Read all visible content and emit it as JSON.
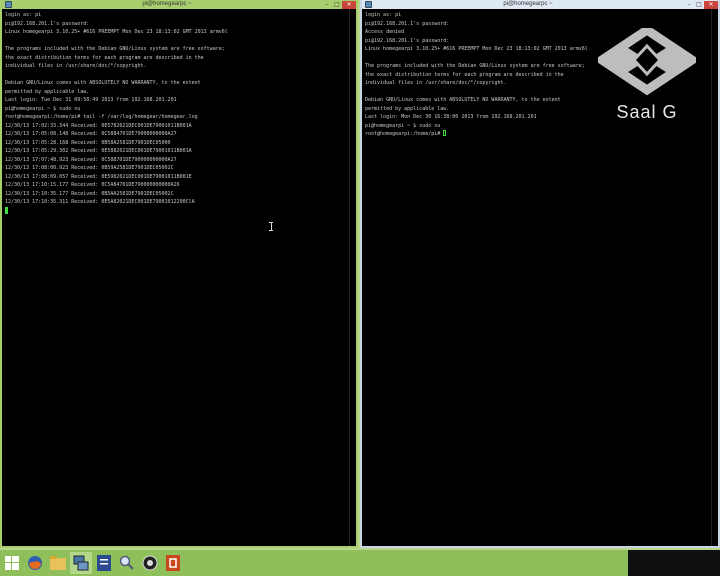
{
  "left_window": {
    "title": "pi@homegearpc ~",
    "lines": [
      "login as: pi",
      "pi@192.168.201.1's password:",
      "Linux homegearpi 3.10.25+ #616 PREEMPT Mon Dec 23 18:13:02 GMT 2013 armv6l",
      "",
      "The programs included with the Debian GNU/Linux system are free software;",
      "the exact distribution terms for each program are described in the",
      "individual files in /usr/share/doc/*/copyright.",
      "",
      "Debian GNU/Linux comes with ABSOLUTELY NO WARRANTY, to the extent",
      "permitted by applicable law.",
      "Last login: Tue Dec 31 09:58:49 2013 from 192.168.201.201",
      "pi@homegearpi ~ $ sudo su",
      "root@homegearpi:/home/pi# tail -f /var/log/homegear/homegear.log",
      "12/30/13 17:02:33.344 Received: 0E5782021DEC001DE79001011B001A",
      "12/30/13 17:05:08.148 Received: 0C5884701DE79000000000A27",
      "12/30/13 17:05:28.168 Received: 0B58A2581DE7901DEC05000",
      "12/30/13 17:05:29.302 Received: 0E5882021DEC001DE79001011B001A",
      "12/30/13 17:07:48.923 Received: 0C588701DE790000000000A27",
      "12/30/13 17:08:00.923 Received: 0B59A2581DE7901DEC05002C",
      "12/30/13 17:08:09.057 Received: 0E5982021DEC001DE79001011B001E",
      "12/30/13 17:10:15.177 Received: 0C5A84701DE790000000000A26",
      "12/30/13 17:10:35.177 Received: 0B5AA2581DE7901DEC05002C",
      "12/30/13 17:10:35.311 Received: 0E5A82021DEC001DE79001012200ClA"
    ]
  },
  "right_window": {
    "title": "pi@homegearpc ~",
    "lines": [
      "login as: pi",
      "pi@192.168.201.1's password:",
      "Access denied",
      "pi@192.168.201.1's password:",
      "Linux homegearpi 3.10.25+ #616 PREEMPT Mon Dec 23 18:13:02 GMT 2013 armv6l",
      "",
      "The programs included with the Debian GNU/Linux system are free software;",
      "the exact distribution terms for each program are described in the",
      "individual files in /usr/share/doc/*/copyright.",
      "",
      "Debian GNU/Linux comes with ABSOLUTELY NO WARRANTY, to the extent",
      "permitted by applicable law.",
      "Last login: Mon Dec 30 16:38:00 2013 from 192.168.201.201",
      "pi@homegearpi ~ $ sudo su"
    ],
    "prompt": "root@homegearpi:/home/pi# "
  },
  "watermark": {
    "text": "Saal G"
  },
  "taskbar": {
    "apps": [
      "windows-start-icon",
      "firefox-icon",
      "file-explorer-icon",
      "putty-icon",
      "word-icon",
      "search-tool-icon",
      "app-icon",
      "powerpoint-icon"
    ],
    "active_app": "putty-icon"
  },
  "colors": {
    "terminal_text": "#c8c8c8",
    "cursor": "#3ee03e",
    "left_frame": "#a8cf6e",
    "right_frame": "#dfe9f3"
  }
}
